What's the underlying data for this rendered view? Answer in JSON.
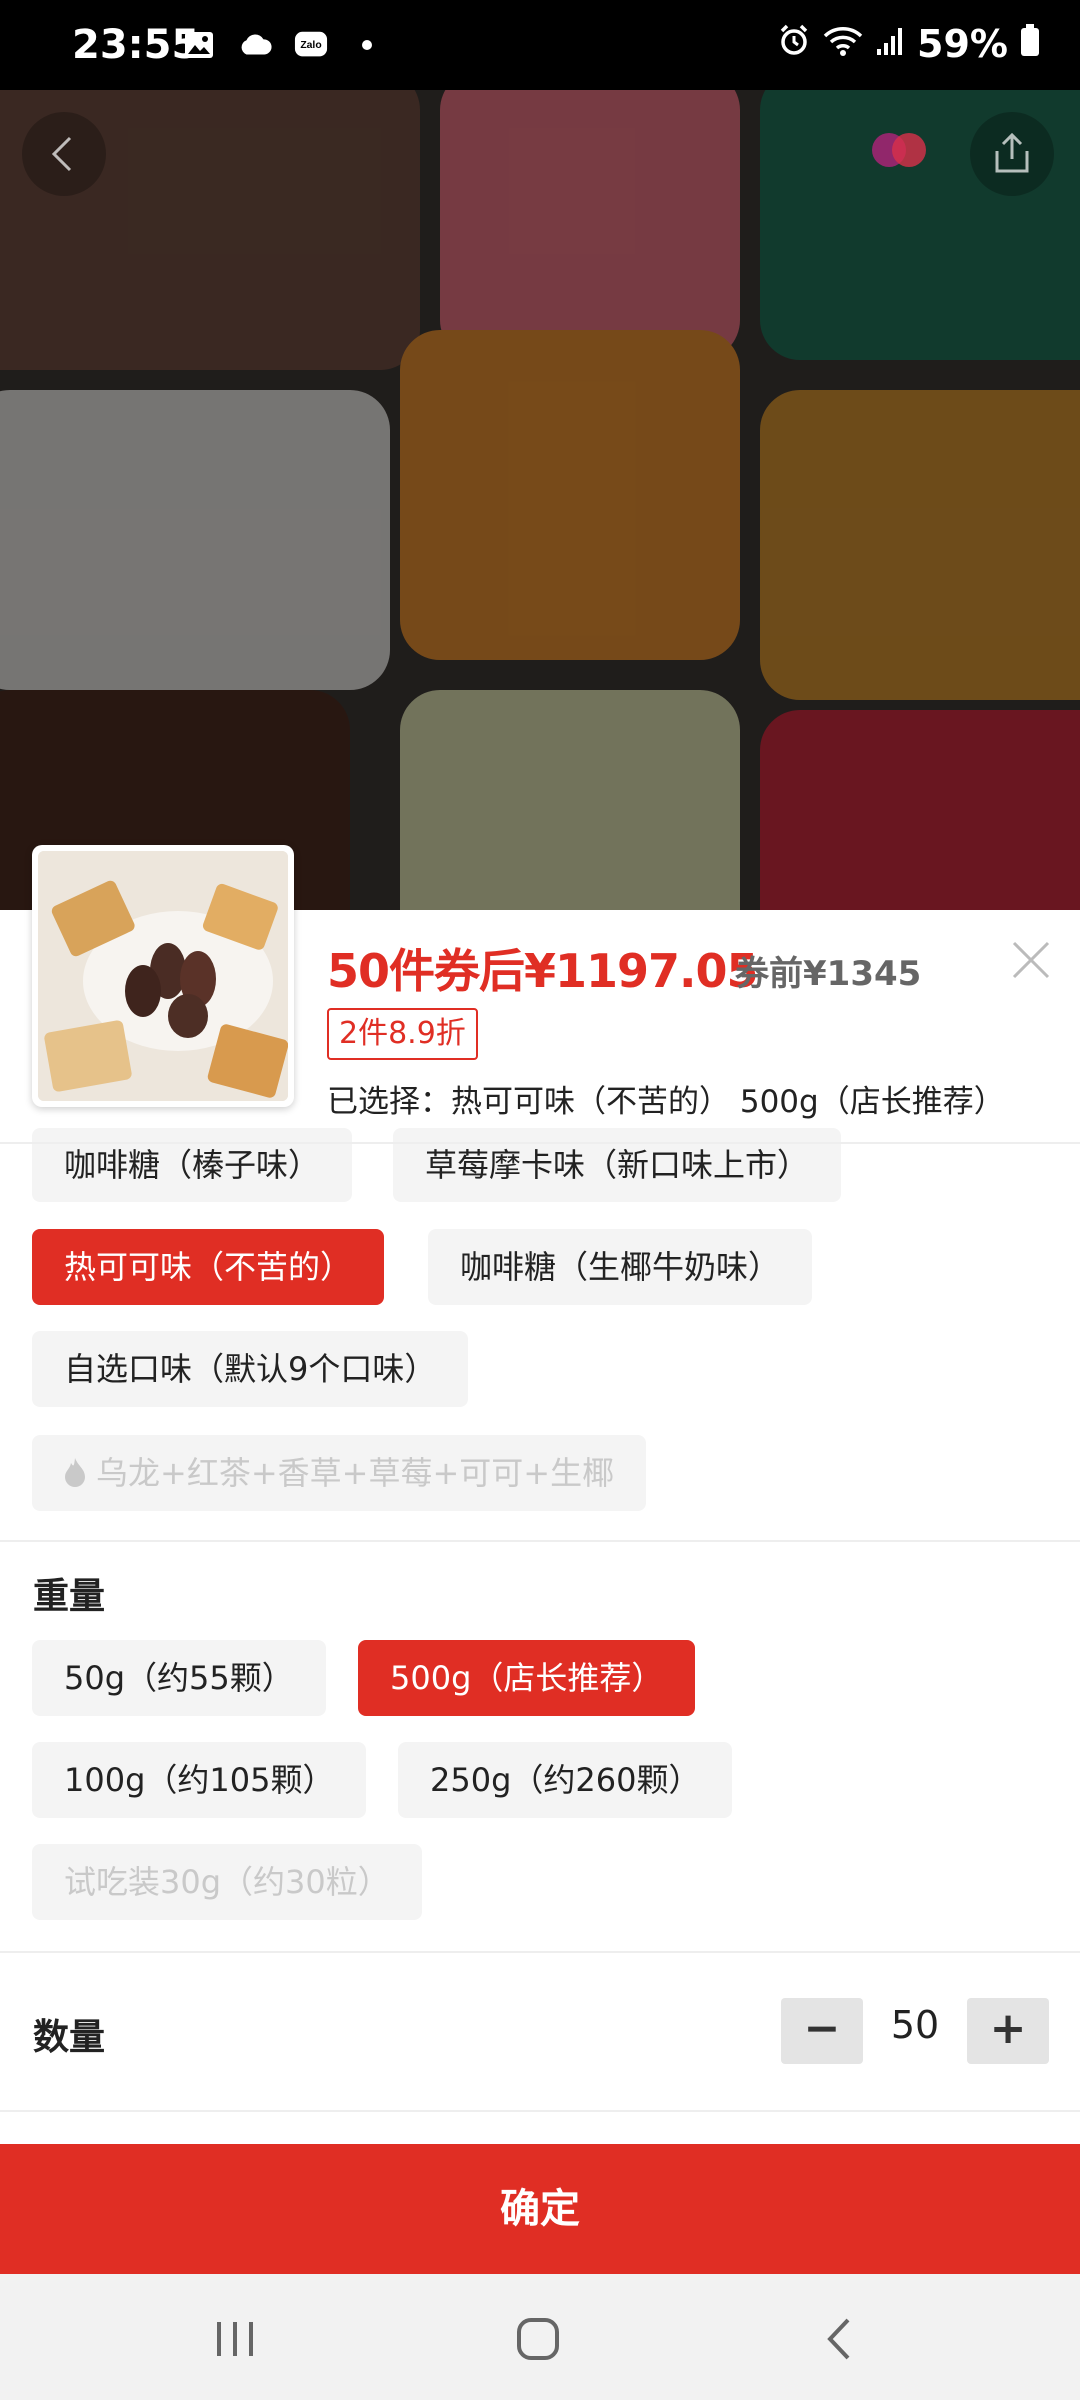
{
  "status_bar": {
    "time": "23:55",
    "battery": "59%",
    "icons_left": [
      "gallery-icon",
      "cloud-icon",
      "zalo-icon",
      "dot-icon"
    ],
    "icons_right": [
      "alarm-icon",
      "wifi-icon",
      "signal-icon",
      "battery-icon"
    ]
  },
  "header": {
    "back_icon": "chevron-left-icon",
    "share_icon": "share-icon"
  },
  "product": {
    "price_after_coupon": "50件券后¥1197.05",
    "price_before": "券前¥1345",
    "promo_tag": "2件8.9折",
    "selected": "已选择：热可可味（不苦的） 500g（店长推荐）"
  },
  "flavors": [
    {
      "label": "咖啡糖（榛子味）",
      "state": "normal"
    },
    {
      "label": "草莓摩卡味（新口味上市）",
      "state": "normal"
    },
    {
      "label": "热可可味（不苦的）",
      "state": "active"
    },
    {
      "label": "咖啡糖（生椰牛奶味）",
      "state": "normal"
    },
    {
      "label": "自选口味（默认9个口味）",
      "state": "normal"
    },
    {
      "label": "乌龙+红茶+香草+草莓+可可+生椰",
      "state": "disabled"
    }
  ],
  "weight": {
    "title": "重量",
    "options": [
      {
        "label": "50g（约55颗）",
        "state": "normal"
      },
      {
        "label": "500g（店长推荐）",
        "state": "active"
      },
      {
        "label": "100g（约105颗）",
        "state": "normal"
      },
      {
        "label": "250g（约260颗）",
        "state": "normal"
      },
      {
        "label": "试吃装30g（约30粒）",
        "state": "disabled"
      }
    ]
  },
  "quantity": {
    "title": "数量",
    "minus": "−",
    "value": "50",
    "plus": "+"
  },
  "confirm_label": "确定",
  "colors": {
    "accent": "#e02e24",
    "option_bg": "#f4f4f4",
    "disabled_text": "#c9c9c9"
  }
}
